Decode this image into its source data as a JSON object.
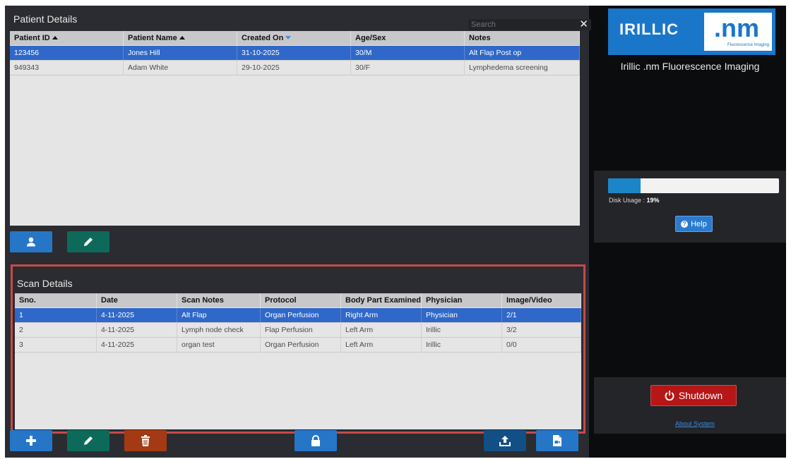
{
  "patient_panel": {
    "title": "Patient Details",
    "search_placeholder": "Search",
    "clear_symbol": "✕",
    "columns": [
      {
        "label": "Patient ID",
        "sort": "up"
      },
      {
        "label": "Patient Name",
        "sort": "up"
      },
      {
        "label": "Created On",
        "sort": "down"
      },
      {
        "label": "Age/Sex",
        "sort": "none"
      },
      {
        "label": "Notes",
        "sort": "none"
      }
    ],
    "rows": [
      {
        "cells": [
          "123456",
          "Jones Hill",
          "31-10-2025",
          "30/M",
          "Alt Flap Post op"
        ],
        "selected": true
      },
      {
        "cells": [
          "949343",
          "Adam White",
          "29-10-2025",
          "30/F",
          "Lymphedema screening"
        ],
        "selected": false
      }
    ],
    "buttons": [
      {
        "name": "add-patient-button",
        "icon": "user-icon",
        "color": "#2676c8"
      },
      {
        "name": "edit-patient-button",
        "icon": "pencil-icon",
        "color": "#0d6a5a"
      }
    ]
  },
  "scan_panel": {
    "title": "Scan Details",
    "columns": [
      "Sno.",
      "Date",
      "Scan Notes",
      "Protocol",
      "Body Part Examined",
      "Physician",
      "Image/Video"
    ],
    "rows": [
      {
        "cells": [
          "1",
          "4-11-2025",
          "Alt Flap",
          "Organ Perfusion",
          "Right Arm",
          "Physician",
          "2/1"
        ],
        "selected": true
      },
      {
        "cells": [
          "2",
          "4-11-2025",
          "Lymph node check",
          "Flap Perfusion",
          "Left Arm",
          "Irillic",
          "3/2"
        ],
        "selected": false
      },
      {
        "cells": [
          "3",
          "4-11-2025",
          "organ test",
          "Organ Perfusion",
          "Left Arm",
          "Irillic",
          "0/0"
        ],
        "selected": false
      }
    ],
    "buttons": [
      {
        "name": "add-scan-button",
        "icon": "plus-icon",
        "color": "#2676c8"
      },
      {
        "name": "edit-scan-button",
        "icon": "pencil-icon",
        "color": "#0d6a5a"
      },
      {
        "name": "delete-scan-button",
        "icon": "trash-icon",
        "color": "#a33a14"
      },
      {
        "name": "lock-scan-button",
        "icon": "lock-icon",
        "color": "#2676c8"
      },
      {
        "name": "upload-button",
        "icon": "upload-icon",
        "color": "#124f85"
      },
      {
        "name": "export-button",
        "icon": "file-video-icon",
        "color": "#2676c8"
      }
    ]
  },
  "sidebar": {
    "logo_text": "IRILLIC",
    "logo_nm": ".nm",
    "logo_sub": "Fluorescence Imaging",
    "app_name": "Irillic .nm Fluorescence Imaging",
    "disk_label": "Disk Usage :",
    "disk_value": "19%",
    "disk_fraction": 0.19,
    "help_label": "Help",
    "shutdown_label": "Shutdown",
    "about_label": "About System",
    "accent": "#1a76c9",
    "danger": "#b61616"
  }
}
